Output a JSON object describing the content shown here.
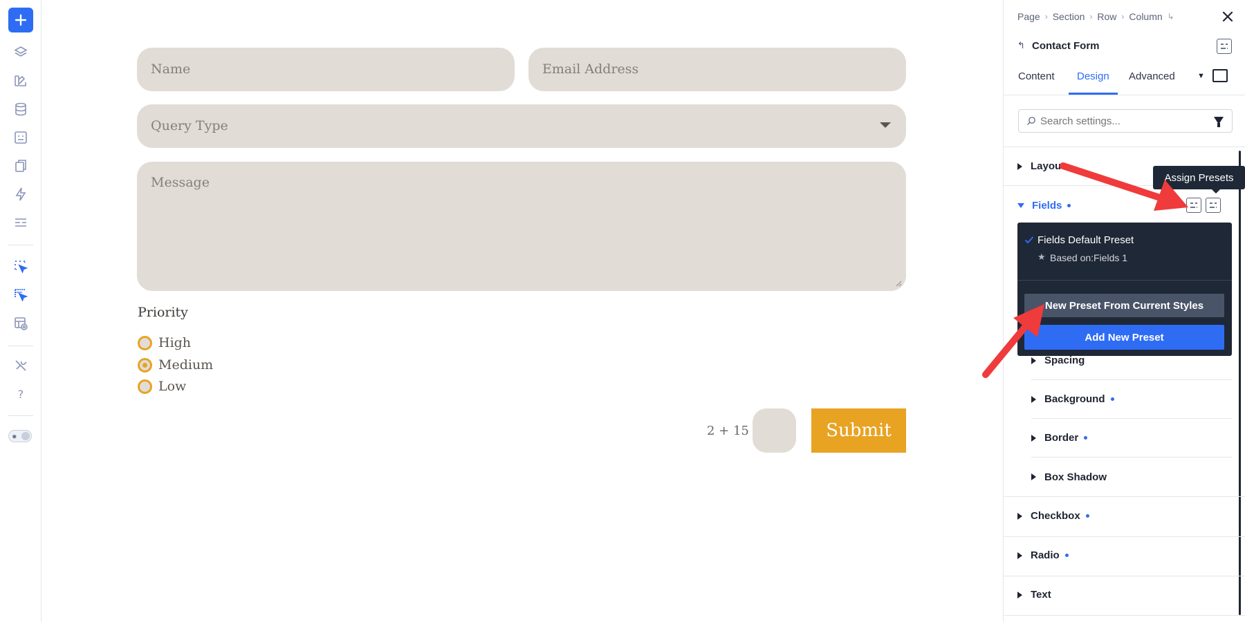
{
  "colors": {
    "accent": "#2e6cf4",
    "field_bg": "#e1dcd6",
    "submit_bg": "#e8a323",
    "dropdown_bg": "#1f2836",
    "annotation_arrow": "#ef3b3b"
  },
  "toolbar": {
    "icons": [
      "plus-icon",
      "layers-icon",
      "theme-icon",
      "database-icon",
      "module-icon",
      "pages-icon",
      "lightning-icon",
      "layout-icon",
      "select-cursor-icon",
      "preset-cursor-icon",
      "preview-icon",
      "tools-icon",
      "help-icon",
      "theme-toggle"
    ],
    "help_label": "?"
  },
  "form": {
    "name_placeholder": "Name",
    "email_placeholder": "Email Address",
    "query_placeholder": "Query Type",
    "message_placeholder": "Message",
    "priority_label": "Priority",
    "priority_options": [
      {
        "label": "High",
        "selected": false
      },
      {
        "label": "Medium",
        "selected": true
      },
      {
        "label": "Low",
        "selected": false
      }
    ],
    "captcha_question": "2 + 15 =",
    "submit_label": "Submit"
  },
  "panel": {
    "breadcrumbs": [
      "Page",
      "Section",
      "Row",
      "Column"
    ],
    "module_title": "Contact Form",
    "tabs": [
      {
        "label": "Content",
        "active": false
      },
      {
        "label": "Design",
        "active": true
      },
      {
        "label": "Advanced",
        "active": false
      }
    ],
    "search_placeholder": "Search settings...",
    "groups": [
      {
        "label": "Layout",
        "expanded": false,
        "modified": false
      },
      {
        "label": "Fields",
        "expanded": true,
        "modified": true
      },
      {
        "label": "Checkbox",
        "expanded": false,
        "modified": true
      },
      {
        "label": "Radio",
        "expanded": false,
        "modified": true
      },
      {
        "label": "Text",
        "expanded": false,
        "modified": false
      }
    ],
    "layout_visible_text": "Layou",
    "field_subgroups": [
      {
        "label": "Spacing",
        "modified": false
      },
      {
        "label": "Background",
        "modified": true
      },
      {
        "label": "Border",
        "modified": true
      },
      {
        "label": "Box Shadow",
        "modified": false
      }
    ]
  },
  "tooltip": {
    "text": "Assign Presets"
  },
  "presets_dropdown": {
    "current_preset": "Fields Default Preset",
    "based_on": "Based on:Fields 1",
    "new_from_current_label": "New Preset From Current Styles",
    "add_new_label": "Add New Preset"
  }
}
